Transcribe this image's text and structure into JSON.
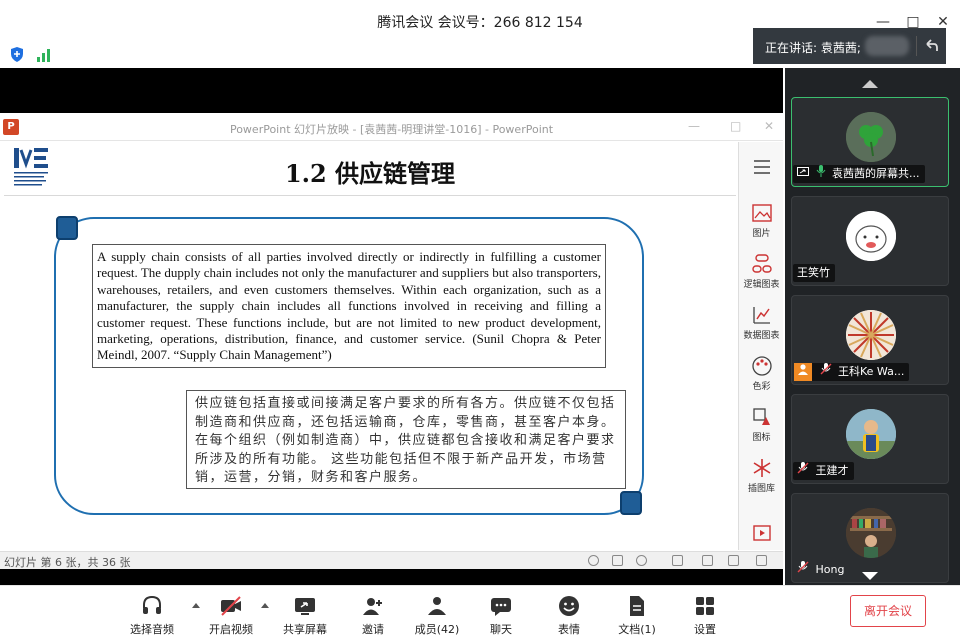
{
  "window": {
    "title": "腾讯会议 会议号：266 812 154",
    "speaking": "正在讲话: 袁茜茜;"
  },
  "ppt": {
    "window_title": "PowerPoint 幻灯片放映 - [袁茜茜-明理讲堂-1016] - PowerPoint",
    "logo_letter": "P",
    "slide": {
      "title": "1.2 供应链管理",
      "english_text": "A supply  chain consists of all parties involved directly or indirectly in fulfilling a customer request. The dupply chain includes not only the manufacturer and suppliers but  also transporters, warehouses,     retailers, and even customers themselves. Within each organization, such as a manufacturer, the supply chain includes all functions involved in receiving and filling  a customer request. These functions include, but are not limited to new product development, marketing, operations, distribution, finance, and customer service.    (Sunil Chopra & Peter Meindl, 2007. “Supply Chain Management”)",
      "chinese_text": "供应链包括直接或间接满足客户要求的所有各方。供应链不仅包括制造商和供应商，还包括运输商，仓库，零售商，甚至客户本身。 在每个组织（例如制造商）中，供应链都包含接收和满足客户要求所涉及的所有功能。 这些功能包括但不限于新产品开发，市场营销，运营，分销，财务和客户服务。"
    },
    "side_tools": [
      {
        "label": "图片",
        "icon": "picture-icon"
      },
      {
        "label": "逻辑图表",
        "icon": "logic-chart-icon"
      },
      {
        "label": "数据图表",
        "icon": "data-chart-icon"
      },
      {
        "label": "色彩",
        "icon": "palette-icon"
      },
      {
        "label": "图标",
        "icon": "shapes-icon"
      },
      {
        "label": "插图库",
        "icon": "illustration-icon"
      }
    ],
    "status_text": "幻灯片 第 6 张，共 36 张"
  },
  "participants": [
    {
      "name": "袁茜茜的屏幕共...",
      "sharing": true,
      "muted": false,
      "active": true
    },
    {
      "name": "王笑竹",
      "sharing": false,
      "muted": null,
      "active": false
    },
    {
      "name": "王科Ke Wa...",
      "sharing": false,
      "muted": true,
      "active": false,
      "has_profile_icon": true
    },
    {
      "name": "王建才",
      "sharing": false,
      "muted": true,
      "active": false
    },
    {
      "name": "Hong",
      "sharing": false,
      "muted": true,
      "active": false
    }
  ],
  "toolbar": {
    "audio": "选择音频",
    "video": "开启视频",
    "share": "共享屏幕",
    "invite": "邀请",
    "members": "成员(42)",
    "chat": "聊天",
    "emoji": "表情",
    "docs": "文档(1)",
    "settings": "设置",
    "leave": "离开会议"
  },
  "colors": {
    "accent_green": "#3bbf6f",
    "leave_red": "#e2444a",
    "slide_frame_blue": "#1f6fb0"
  }
}
